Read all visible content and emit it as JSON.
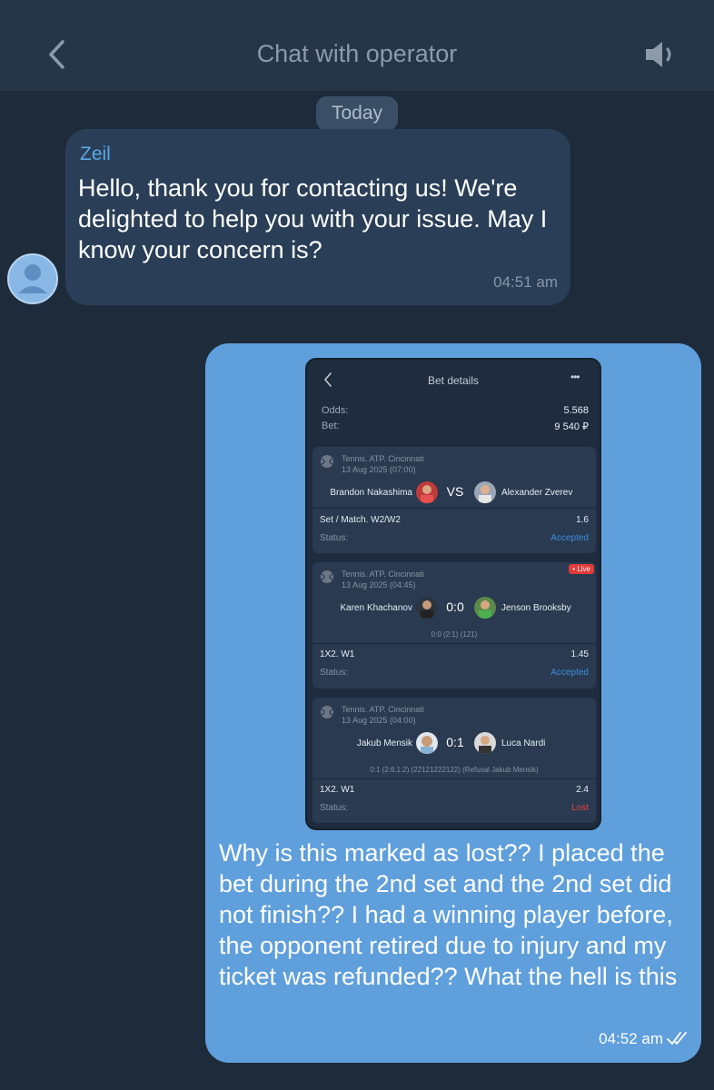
{
  "header": {
    "title": "Chat with operator",
    "back_icon": "chevron-left-icon",
    "sound_icon": "speaker-icon"
  },
  "day_separator": "Today",
  "incoming": {
    "sender": "Zeil",
    "text": "Hello, thank you for contacting us! We're delighted to help you with your issue. May I know your concern is?",
    "time": "04:51 am",
    "avatar_icon": "user-avatar-icon"
  },
  "outgoing": {
    "text": "Why is this marked as lost?? I placed the bet during the 2nd set and the 2nd set did not finish?? I had a winning player before, the opponent retired due to injury and my ticket was refunded?? What the hell is this",
    "time": "04:52 am",
    "status_icon": "double-check-icon",
    "screenshot": {
      "title": "Bet details",
      "more": "•••",
      "odds_label": "Odds:",
      "odds_value": "5.568",
      "bet_label": "Bet:",
      "bet_value": "9 540 ₽",
      "cards": [
        {
          "league": "Tennis. ATP. Cincinnati",
          "date": "13 Aug 2025 (07:00)",
          "team1": "Brandon Nakashima",
          "center": "VS",
          "team2": "Alexander Zverev",
          "live": "",
          "score_detail": "",
          "market": "Set / Match. W2/W2",
          "odd": "1.6",
          "status_label": "Status:",
          "status": "Accepted",
          "status_color": "#3d8fe0"
        },
        {
          "league": "Tennis. ATP. Cincinnati",
          "date": "13 Aug 2025 (04:45)",
          "team1": "Karen Khachanov",
          "center": "0:0",
          "team2": "Jenson Brooksby",
          "live": "• Live",
          "score_detail": "0:0 (2:1) (121)",
          "market": "1X2. W1",
          "odd": "1.45",
          "status_label": "Status:",
          "status": "Accepted",
          "status_color": "#3d8fe0"
        },
        {
          "league": "Tennis. ATP. Cincinnati",
          "date": "13 Aug 2025 (04:00)",
          "team1": "Jakub Mensik",
          "center": "0:1",
          "team2": "Luca Nardi",
          "live": "",
          "score_detail": "0:1 (2:6,1:2) (22121222122) (Refusal Jakub Mensik)",
          "market": "1X2. W1",
          "odd": "2.4",
          "status_label": "Status:",
          "status": "Lost",
          "status_color": "#e64545"
        }
      ]
    }
  },
  "colors": {
    "background": "#1e2b3b",
    "header": "#253649",
    "incoming_bubble": "#2a3f57",
    "outgoing_bubble": "#5f9fdc",
    "accent": "#5aa8e6"
  }
}
